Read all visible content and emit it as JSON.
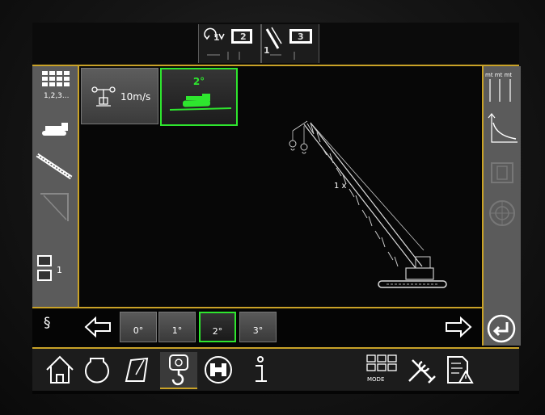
{
  "header": {
    "hook_count": "1",
    "reeving_top": "2",
    "config_count": "1",
    "reeving_second": "3"
  },
  "sidebar_left": {
    "counter_label": "1,2,3...",
    "reeving_count": "1"
  },
  "main": {
    "wind_speed": "10m/s",
    "tilt": "2°",
    "hook_reeving": "1 x"
  },
  "selector": {
    "section_symbol": "§",
    "options": [
      "0°",
      "1°",
      "2°",
      "3°"
    ],
    "selected_index": 2
  },
  "nav": {
    "mode_label": "MODE"
  },
  "colors": {
    "accent": "#c9a227",
    "active": "#2ee62e",
    "panel": "#5b5b5b"
  },
  "icons": {
    "top": [
      "slewing-hook-icon",
      "reeving-icon",
      "boom-config-icon",
      "reeving-icon"
    ],
    "left": [
      "grid-icon",
      "crawler-icon",
      "boom-icon",
      "luffing-jib-icon",
      "reeving-icon"
    ],
    "right": [
      "load-chart-icon",
      "load-curve-icon",
      "crane-front-icon",
      "wheel-icon",
      "enter-icon"
    ],
    "nav": [
      "home-icon",
      "engine-icon",
      "ground-pressure-icon",
      "hook-icon",
      "crawler-config-icon",
      "info-icon",
      "mode-icon",
      "tools-icon",
      "report-icon"
    ]
  }
}
